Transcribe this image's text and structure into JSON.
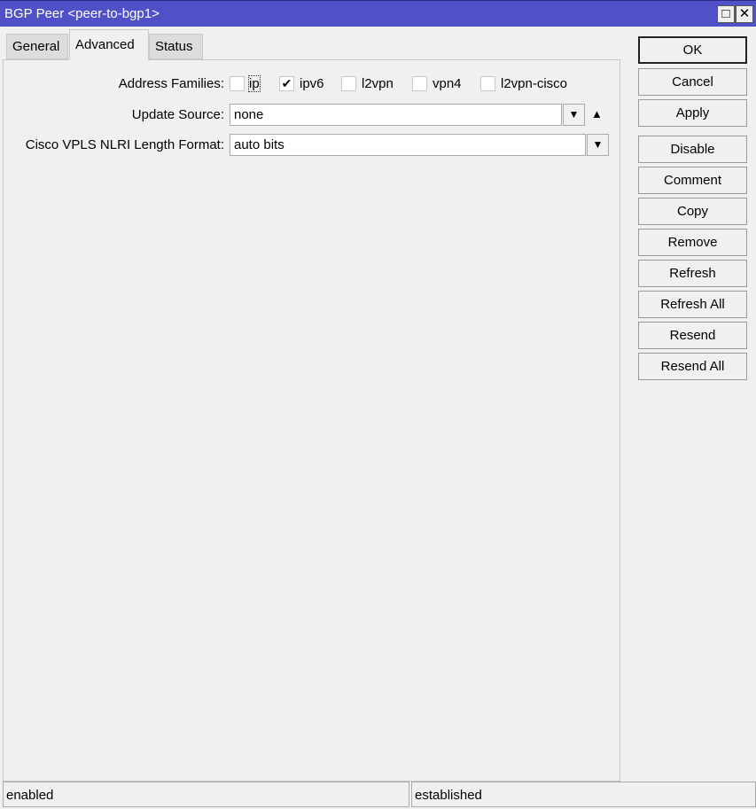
{
  "window": {
    "title": "BGP Peer <peer-to-bgp1>",
    "maximize_icon": "□",
    "close_icon": "✕"
  },
  "tabs": [
    {
      "label": "General"
    },
    {
      "label": "Advanced"
    },
    {
      "label": "Status"
    }
  ],
  "form": {
    "address_families": {
      "label": "Address Families:",
      "options": [
        {
          "label": "ip",
          "checked": false
        },
        {
          "label": "ipv6",
          "checked": true
        },
        {
          "label": "l2vpn",
          "checked": false
        },
        {
          "label": "vpn4",
          "checked": false
        },
        {
          "label": "l2vpn-cisco",
          "checked": false
        }
      ]
    },
    "update_source": {
      "label": "Update Source:",
      "value": "none"
    },
    "cisco_vpls": {
      "label": "Cisco VPLS NLRI Length Format:",
      "value": "auto bits"
    }
  },
  "buttons": [
    "OK",
    "Cancel",
    "Apply",
    "Disable",
    "Comment",
    "Copy",
    "Remove",
    "Refresh",
    "Refresh All",
    "Resend",
    "Resend All"
  ],
  "status": {
    "left": "enabled",
    "right": "established"
  },
  "colors": {
    "titlebar": "#5050c8"
  }
}
